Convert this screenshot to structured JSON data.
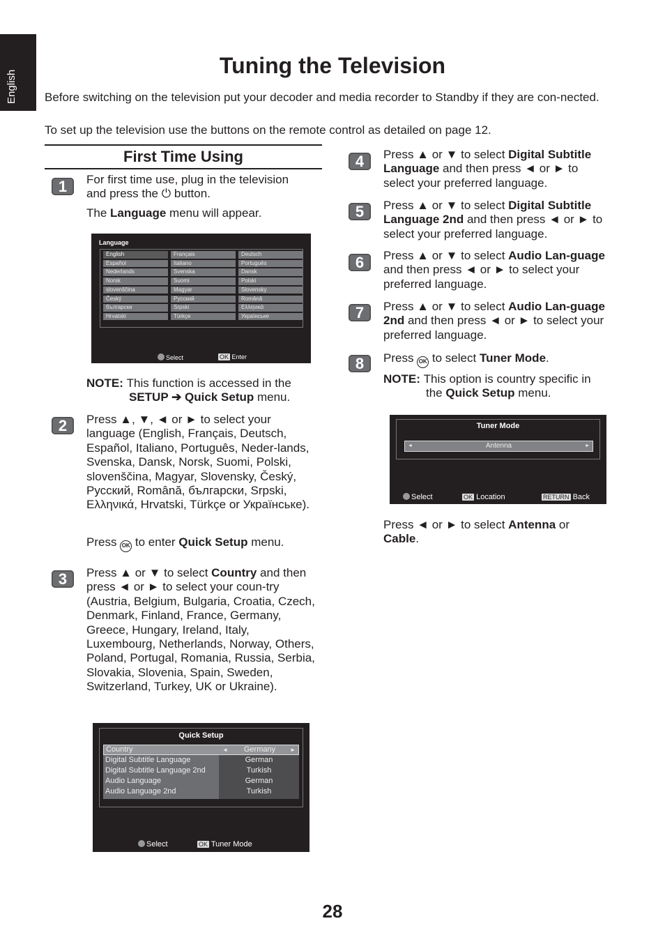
{
  "sidebar_tab": "English",
  "title": "Tuning the Television",
  "intro": [
    "Before switching on the television put your decoder and media recorder to Standby if they are con-nected.",
    "To set up the television use the buttons on the remote control as detailed on page 12."
  ],
  "section_title": "First Time Using",
  "steps": [
    {
      "num": "1",
      "paras": [
        [
          {
            "t": "For first time use, plug in the television and press the "
          },
          {
            "icon": "power"
          },
          {
            "t": " button."
          }
        ],
        [
          {
            "t": "The "
          },
          {
            "t": "Language",
            "b": 1
          },
          {
            "t": " menu will appear."
          }
        ]
      ]
    },
    {
      "num": "2",
      "paras": [
        [
          {
            "t": "Press ▲, ▼, ◄ or ► to select your language (English, Français, Deutsch, Español, Italiano, Português, Neder-lands, Svenska, Dansk, Norsk, Suomi, Polski, slovenščina, Magyar, Slovensky, Český, Русский, Română, български, Srpski, Ελληνικά, Hrvatski, Türkçe or Українське)."
          }
        ],
        [
          {
            "t": "Press "
          },
          {
            "icon": "ok"
          },
          {
            "t": " to enter "
          },
          {
            "t": "Quick Setup",
            "b": 1
          },
          {
            "t": " menu."
          }
        ]
      ]
    },
    {
      "num": "3",
      "paras": [
        [
          {
            "t": "Press ▲ or ▼ to select "
          },
          {
            "t": "Country",
            "b": 1
          },
          {
            "t": " and then press ◄ or ► to select your coun-try (Austria, Belgium, Bulgaria, Croatia, Czech, Denmark, Finland, France, Germany, Greece, Hungary, Ireland, Italy, Luxembourg, Netherlands, Norway, Others, Poland, Portugal, Romania, Russia, Serbia, Slovakia, Slovenia, Spain, Sweden, Switzerland, Turkey, UK or Ukraine)."
          }
        ]
      ]
    },
    {
      "num": "4",
      "paras": [
        [
          {
            "t": "Press ▲ or ▼ to select "
          },
          {
            "t": "Digital Subtitle Language",
            "b": 1
          },
          {
            "t": " and then press ◄ or ► to select your preferred language."
          }
        ]
      ]
    },
    {
      "num": "5",
      "paras": [
        [
          {
            "t": "Press ▲ or ▼ to select "
          },
          {
            "t": "Digital Subtitle Language 2nd",
            "b": 1
          },
          {
            "t": " and then press ◄ or ► to select your preferred language."
          }
        ]
      ]
    },
    {
      "num": "6",
      "paras": [
        [
          {
            "t": "Press ▲ or ▼ to select "
          },
          {
            "t": "Audio Lan-guage",
            "b": 1
          },
          {
            "t": " and then press ◄ or ► to select your preferred language."
          }
        ]
      ]
    },
    {
      "num": "7",
      "paras": [
        [
          {
            "t": "Press ▲ or ▼ to select "
          },
          {
            "t": "Audio Lan-guage 2nd",
            "b": 1
          },
          {
            "t": " and then press ◄ or ► to select your preferred language."
          }
        ]
      ]
    },
    {
      "num": "8",
      "paras": [
        [
          {
            "t": "Press "
          },
          {
            "icon": "ok"
          },
          {
            "t": " to select "
          },
          {
            "t": "Tuner Mode",
            "b": 1
          },
          {
            "t": "."
          }
        ]
      ]
    }
  ],
  "note1": [
    {
      "t": "NOTE: ",
      "b": 1
    },
    {
      "t": "This function is accessed in the "
    },
    {
      "br": 1
    },
    {
      "t": "SETUP ➔ Quick Setup",
      "b": 1
    },
    {
      "t": " menu."
    }
  ],
  "note2": [
    {
      "t": "NOTE: ",
      "b": 1
    },
    {
      "t": "This option is country specific in "
    },
    {
      "br": 1
    },
    {
      "t": "the "
    },
    {
      "t": "Quick Setup",
      "b": 1
    },
    {
      "t": " menu."
    }
  ],
  "antenna_text": [
    {
      "t": "Press ◄ or ► to select "
    },
    {
      "t": "Antenna",
      "b": 1
    },
    {
      "t": " or "
    },
    {
      "t": "Cable",
      "b": 1
    },
    {
      "t": "."
    }
  ],
  "language_screen": {
    "title": "Language",
    "items": [
      "English",
      "Français",
      "Deutsch",
      "Español",
      "Italiano",
      "Português",
      "Nederlands",
      "Svenska",
      "Dansk",
      "Norsk",
      "Suomi",
      "Polski",
      "slovenščina",
      "Magyar",
      "Slovensky",
      "Český",
      "Русский",
      "Română",
      "български",
      "Srpski",
      "Ελληνικά",
      "Hrvatski",
      "Türkçe",
      "Українське"
    ],
    "selected": "English",
    "select": "Select",
    "ok": "OK",
    "enter": "Enter"
  },
  "quick_setup_screen": {
    "title": "Quick Setup",
    "rows": [
      {
        "label": "Country",
        "value": "Germany"
      },
      {
        "label": "Digital Subtitle Language",
        "value": "German"
      },
      {
        "label": "Digital Subtitle Language 2nd",
        "value": "Turkish"
      },
      {
        "label": "Audio Language",
        "value": "German"
      },
      {
        "label": "Audio Language 2nd",
        "value": "Turkish"
      }
    ],
    "select": "Select",
    "ok": "OK",
    "action": "Tuner Mode"
  },
  "tuner_screen": {
    "title": "Tuner Mode",
    "value": "Antenna",
    "select": "Select",
    "ok": "OK",
    "location": "Location",
    "return": "RETURN",
    "back": "Back"
  },
  "page_number": "28"
}
